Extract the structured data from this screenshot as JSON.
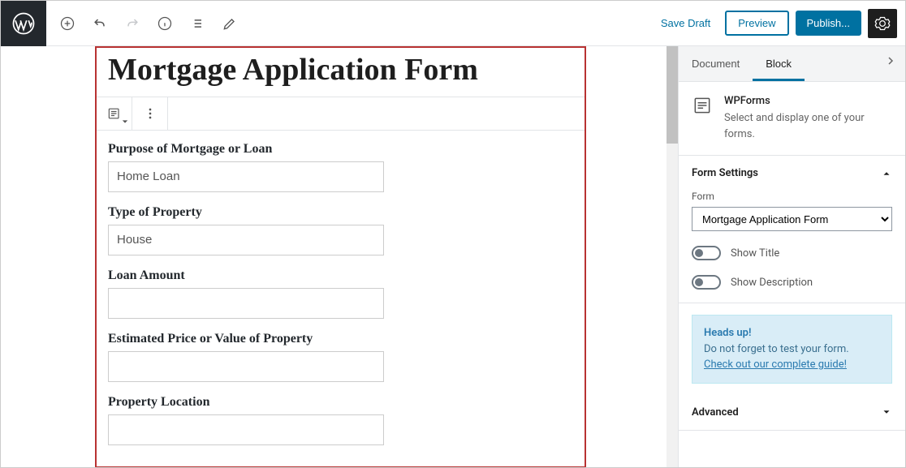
{
  "topbar": {
    "save_draft": "Save Draft",
    "preview": "Preview",
    "publish": "Publish..."
  },
  "page": {
    "title": "Mortgage Application Form"
  },
  "form_fields": [
    {
      "label": "Purpose of Mortgage or Loan",
      "value": "Home Loan"
    },
    {
      "label": "Type of Property",
      "value": "House"
    },
    {
      "label": "Loan Amount",
      "value": ""
    },
    {
      "label": "Estimated Price or Value of Property",
      "value": ""
    },
    {
      "label": "Property Location",
      "value": ""
    }
  ],
  "sidebar": {
    "tabs": {
      "document": "Document",
      "block": "Block"
    },
    "block_card": {
      "name": "WPForms",
      "desc": "Select and display one of your forms."
    },
    "panels": {
      "form_settings": {
        "title": "Form Settings",
        "form_label": "Form",
        "form_selected": "Mortgage Application Form",
        "show_title": "Show Title",
        "show_description": "Show Description"
      },
      "advanced": "Advanced"
    },
    "notice": {
      "heads": "Heads up!",
      "body": "Do not forget to test your form.",
      "link": "Check out our complete guide!"
    }
  }
}
